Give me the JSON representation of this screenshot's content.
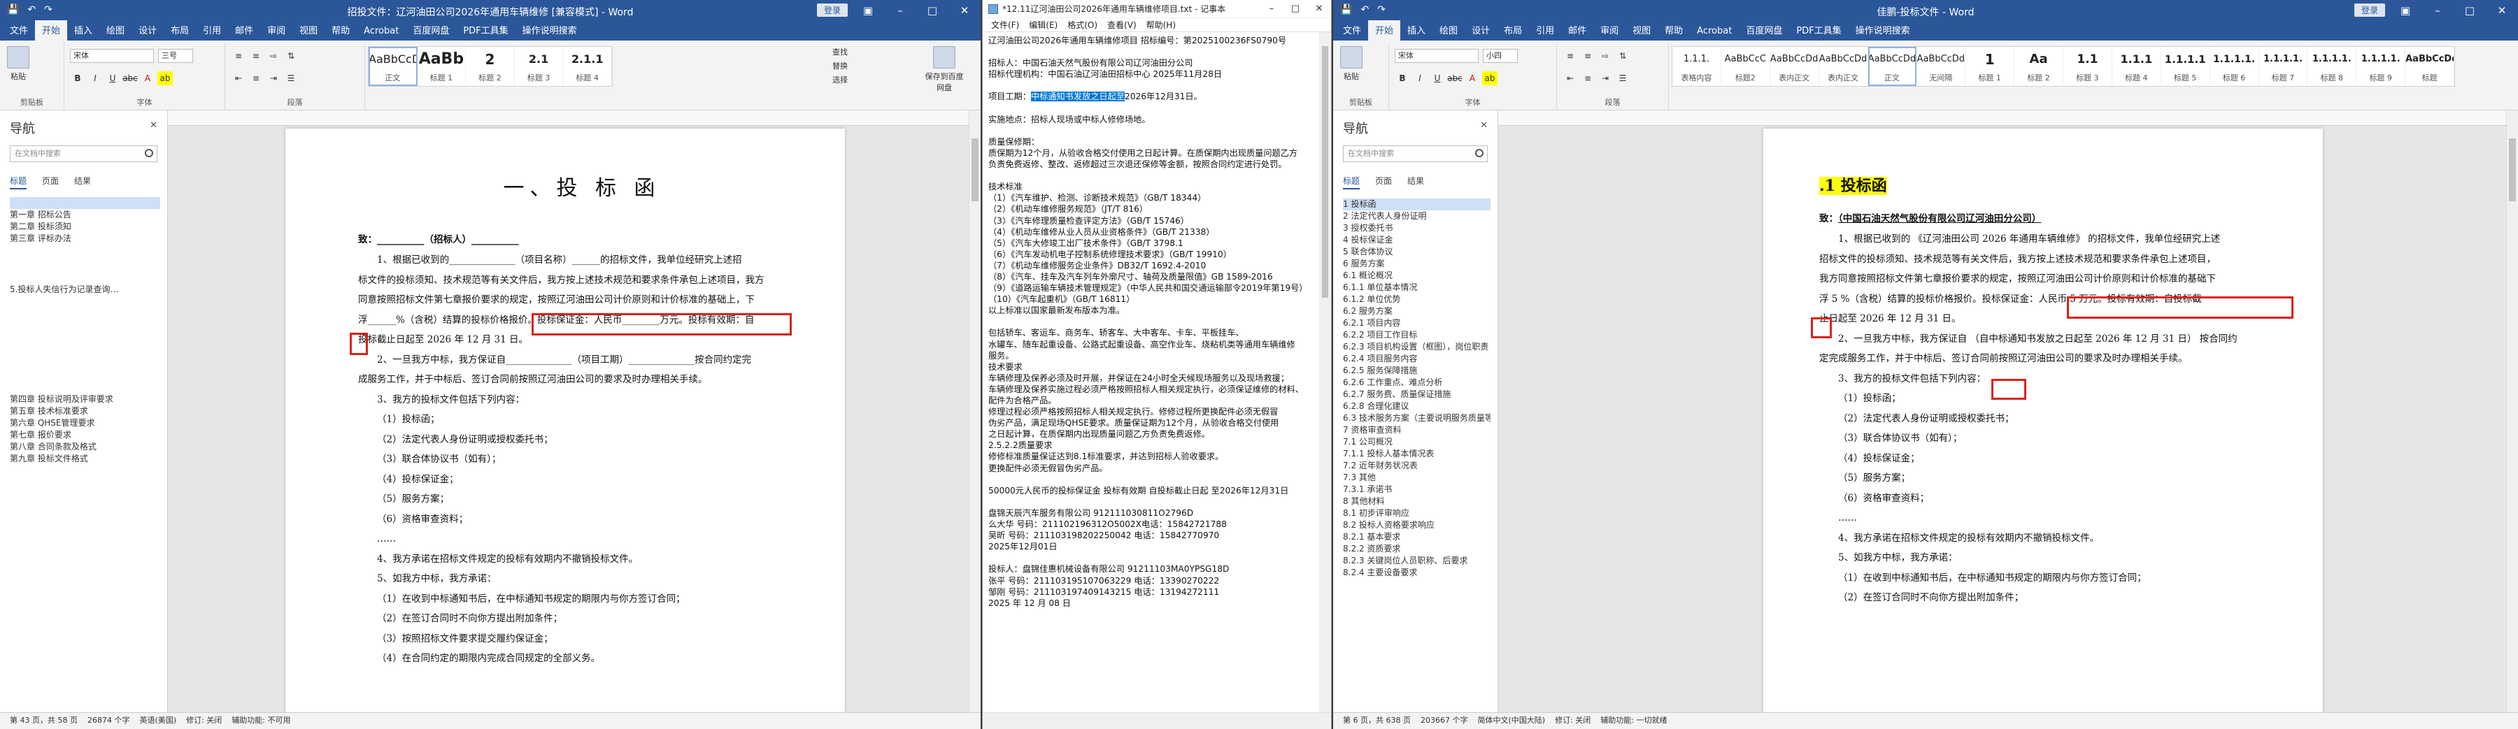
{
  "w1": {
    "title": "招投文件：辽河油田公司2026年通用车辆维修 [兼容模式] - Word",
    "signin": "登录",
    "tabs": [
      "文件",
      "开始",
      "插入",
      "绘图",
      "设计",
      "布局",
      "引用",
      "邮件",
      "审阅",
      "视图",
      "帮助",
      "Acrobat",
      "百度网盘",
      "PDF工具集",
      "操作说明搜索"
    ],
    "tellme": "操作说明搜索",
    "ribbon": {
      "paste": "粘贴",
      "clipboard": "剪贴板",
      "font": "字体",
      "paragraph": "段落",
      "font_name": "宋体",
      "font_size": "三号",
      "styles": [
        {
          "pv": "AaBbCcDd",
          "nm": "正文"
        },
        {
          "pv": "AaBb",
          "nm": "标题 1"
        },
        {
          "pv": "2",
          "nm": "标题 2"
        },
        {
          "pv": "2.1",
          "nm": "标题 3"
        },
        {
          "pv": "2.1.1",
          "nm": "标题 4"
        }
      ],
      "find": "查找",
      "replace": "替换",
      "select": "选择",
      "save_baidu": "保存到百度网盘"
    },
    "nav": {
      "title": "导航",
      "search": "在文档中搜索",
      "tabs": [
        "标题",
        "页面",
        "结果"
      ],
      "items": [
        "第一章 招标公告",
        "第二章 投标须知",
        "第三章 评标办法",
        "5.投标人失信行为记录查询…",
        "第四章 投标说明及评审要求",
        "第五章 技术标准要求",
        "第六章 QHSE管理要求",
        "第七章 报价要求",
        "第八章 合同条款及格式",
        "第九章 投标文件格式",
        ""
      ]
    },
    "doc": {
      "title": "一、投 标 函",
      "lines": [
        "致：__________（招标人）__________",
        "1、根据已收到的______________（项目名称）______的招标文件，我单位经研究上述招",
        "标文件的投标须知、技术规范等有关文件后，我方按上述技术规范和要求条件承包上述项目，我方",
        "同意按照招标文件第七章报价要求的规定，按照辽河油田公司计价原则和计价标准的基础上，下",
        "浮______%（含税）结算的投标价格报价。投标保证金：人民币________万元。投标有效期：自",
        "投标截止日起至 2026 年 12 月 31 日。",
        "",
        "2、一旦我方中标，我方保证自______________（项目工期）______________按合同约定完",
        "成服务工作，并于中标后、签订合同前按照辽河油田公司的要求及时办理相关手续。",
        "3、我方的投标文件包括下列内容：",
        "（1）投标函；",
        "（2）法定代表人身份证明或授权委托书；",
        "（3）联合体协议书（如有）；",
        "（4）投标保证金；",
        "（5）服务方案；",
        "（6）资格审查资料；",
        "……",
        "4、我方承诺在招标文件规定的投标有效期内不撤销投标文件。",
        "5、如我方中标，我方承诺：",
        "（1）在收到中标通知书后，在中标通知书规定的期限内与你方签订合同；",
        "（2）在签订合同时不向你方提出附加条件；",
        "（3）按照招标文件要求提交履约保证金；",
        "（4）在合同约定的期限内完成合同规定的全部义务。",
        "",
        ""
      ]
    },
    "status": {
      "page": "第 43 页，共 58 页",
      "words": "26874 个字",
      "lang": "英语(美国)",
      "track": "修订: 关闭",
      "access": "辅助功能: 不可用"
    }
  },
  "w2": {
    "title": "*12.11辽河油田公司2026年通用车辆维修项目.txt - 记事本",
    "menu": [
      "文件(F)",
      "编辑(E)",
      "格式(O)",
      "查看(V)",
      "帮助(H)"
    ],
    "lines": [
      "辽河油田公司2026年通用车辆维修项目           招标编号：第2025100236FS0790号",
      "",
      "招标人：中国石油天然气股份有限公司辽河油田分公司",
      "招标代理机构：中国石油辽河油田招标中心          2025年11月28日",
      "",
      "项目工期：@@SEL@@中标通知书发放之日起至@@END@@2026年12月31日。",
      "",
      "实施地点：招标人现场或中标人修修场地。",
      "",
      "质量保修期：",
      "质保期为12个月，从验收合格交付使用之日起计算。在质保期内出现质量问题乙方",
      "负责免费返修、整改、返修超过三次退还保修等金额，按照合同约定进行处罚。",
      "",
      "技术标准",
      "（1）《汽车维护、检测、诊断技术规范》（GB/T 18344）",
      "（2）《机动车维修服务规范》（JT/T 816）",
      "（3）《汽车修理质量检查评定方法》（GB/T 15746）",
      "（4）《机动车维修从业人员从业资格条件》（GB/T 21338）",
      "（5）《汽车大修竣工出厂技术条件》（GB/T 3798.1",
      "（6）《汽车发动机电子控制系统修理技术要求》（GB/T 19910）",
      "（7）《机动车维修服务企业条件》DB32/T 1692.4-2010",
      "（8）《汽车、挂车及汽车列车外廓尺寸、轴荷及质量限值》GB 1589-2016",
      "（9）《道路运输车辆技术管理规定》（中华人民共和国交通运输部令2019年第19号）",
      "（10）《汽车起重机》（GB/T 16811）",
      "以上标准以国家最新发布版本为准。",
      "",
      "包括轿车、客运车、商务车、轿客车、大中客车、卡车、平板挂车、",
      "水罐车、随车起重设备、公路式起重设备、高空作业车、烧粘机类等通用车辆维修",
      "服务。",
      "技术要求",
      "车辆修理及保养必须及时开展，并保证在24小时全天候现场服务以及现场救援；",
      "车辆修理及保养实施过程必须严格按照招标人相关规定执行，必须保证维修的材料、",
      "配件为合格产品。",
      "修理过程必须严格按照招标人相关规定执行。修修过程所更换配件必须无假冒",
      "伪劣产品，满足现场QHSE要求。质量保证期为12个月，从验收合格交付使用",
      "之日起计算，在质保期内出现质量问题乙方负责免费返修。",
      "2.5.2.2质量要求",
      "修修标准质量保证达到8.1标准要求，并达到招标人验收要求。",
      "更换配件必须无假冒伪劣产品。",
      "",
      "50000元人民币的投标保证金    投标有效期  自投标截止日起 至2026年12月31日",
      "",
      "盘锦天辰汽车服务有限公司 912111030811O2796D",
      "么大华   号码：211102196312O5002X电话：15842721788",
      "吴昕    号码：211103198202250042 电话：15842770970",
      "2025年12月01日",
      "",
      "投标人：盘锦佳惠机械设备有限公司 91211103MA0YPSG18D",
      "张平  号码：211103195107063229  电话：13390270222",
      "邹刚  号码：211103197409143215  电话：13194272111",
      "2025 年 12 月 08 日"
    ],
    "status": ""
  },
  "w3": {
    "title": "佳鹏-投标文件 - Word",
    "signin": "登录",
    "tabs": [
      "文件",
      "开始",
      "插入",
      "绘图",
      "设计",
      "布局",
      "引用",
      "邮件",
      "审阅",
      "视图",
      "帮助",
      "Acrobat",
      "百度网盘",
      "PDF工具集",
      "操作说明搜索"
    ],
    "tellme": "操作说明搜索",
    "ribbon": {
      "paste": "粘贴",
      "clipboard": "剪贴板",
      "font": "字体",
      "paragraph": "段落",
      "font_name": "宋体",
      "font_size": "小四",
      "styles": [
        {
          "pv": "1.1.1.",
          "nm": "表格内容"
        },
        {
          "pv": "AaBbCcC",
          "nm": "标题2"
        },
        {
          "pv": "AaBbCcDd",
          "nm": "表内正文"
        },
        {
          "pv": "AaBbCcDd",
          "nm": "表内正文"
        },
        {
          "pv": "AaBbCcDd",
          "nm": "正文"
        },
        {
          "pv": "AaBbCcDd",
          "nm": "无间隔"
        },
        {
          "pv": "1",
          "nm": "标题 1"
        },
        {
          "pv": "Aa",
          "nm": "标题 2"
        },
        {
          "pv": "1.1",
          "nm": "标题 3"
        },
        {
          "pv": "1.1.1",
          "nm": "标题 4"
        },
        {
          "pv": "1.1.1.1",
          "nm": "标题 5"
        },
        {
          "pv": "1.1.1.1.",
          "nm": "标题 6"
        },
        {
          "pv": "1.1.1.1.",
          "nm": "标题 7"
        },
        {
          "pv": "1.1.1.1.",
          "nm": "标题 8"
        },
        {
          "pv": "1.1.1.1.",
          "nm": "标题 9"
        },
        {
          "pv": "AaBbCcDd",
          "nm": "标题"
        }
      ]
    },
    "nav": {
      "title": "导航",
      "search": "在文档中搜索",
      "tabs": [
        "标题",
        "页面",
        "结果"
      ],
      "items": [
        "1 投标函",
        "2 法定代表人身份证明",
        "3 授权委托书",
        "4 投标保证金",
        "5 联合体协议",
        "6 服务方案",
        "  6.1 概论概况",
        "    6.1.1 单位基本情况",
        "    6.1.2 单位优势",
        "  6.2 服务方案",
        "    6.2.1 项目内容",
        "    6.2.2 项目工作目标",
        "    6.2.3 项目机构设置（框图），岗位职责",
        "    6.2.4 项目服务内容",
        "    6.2.5 服务保障措施",
        "    6.2.6 工作重点、难点分析",
        "    6.2.7 服务费、质量保证措施",
        "    6.2.8 合理化建议",
        "  6.3 技术服务方案（主要说明服务质量等）",
        "7 资格审查资料",
        "  7.1 公司概况",
        "    7.1.1 投标人基本情况表",
        "  7.2 近年财务状况表",
        "  7.3 其他",
        "    7.3.1 承诺书",
        "8 其他材料",
        "  8.1 初步评审响应",
        "  8.2 投标人资格要求响应",
        "    8.2.1 基本要求",
        "    8.2.2 资质要求",
        "    8.2.3 关键岗位人员职称、后要求",
        "    8.2.4 主要设备要求"
      ]
    },
    "doc": {
      "heading": ".1  投标函",
      "to_label": "致：",
      "to_name": "（中国石油天然气股份有限公司辽河油田分公司）",
      "lines": [
        "1、根据已收到的 《辽河油田公司 2026 年通用车辆维修》 的招标文件，我单位经研究上述",
        "招标文件的投标须知、技术规范等有关文件后，我方按上述技术规范和要求条件承包上述项目，",
        "我方同意按照招标文件第七章报价要求的规定，按照辽河油田公司计价原则和计价标准的基础下",
        "浮   5   %（含税）结算的投标价格报价。投标保证金：人民币  5  万元。投标有效期：自投标截",
        "止日起至 2026 年 12 月 31 日。",
        "2、一旦我方中标，我方保证自 （自中标通知书发放之日起至 2026 年 12 月 31 日） 按合同约",
        "定完成服务工作，并于中标后、签订合同前按照辽河油田公司的要求及时办理相关手续。",
        "3、我方的投标文件包括下列内容：",
        "（1）投标函；",
        "（2）法定代表人身份证明或授权委托书；",
        "（3）联合体协议书（如有）；",
        "（4）投标保证金；",
        "（5）服务方案；",
        "（6）资格审查资料；",
        "……",
        "4、我方承诺在招标文件规定的投标有效期内不撤销投标文件。",
        "5、如我方中标，我方承诺：",
        "（1）在收到中标通知书后，在中标通知书规定的期限内与你方签订合同；",
        "（2）在签订合同时不向你方提出附加条件；",
        "",
        ""
      ]
    },
    "status": {
      "page": "第 6 页，共 638 页",
      "words": "203667 个字",
      "lang": "简体中文(中国大陆)",
      "track": "修订: 关闭",
      "access": "辅助功能: 一切就绪"
    }
  }
}
